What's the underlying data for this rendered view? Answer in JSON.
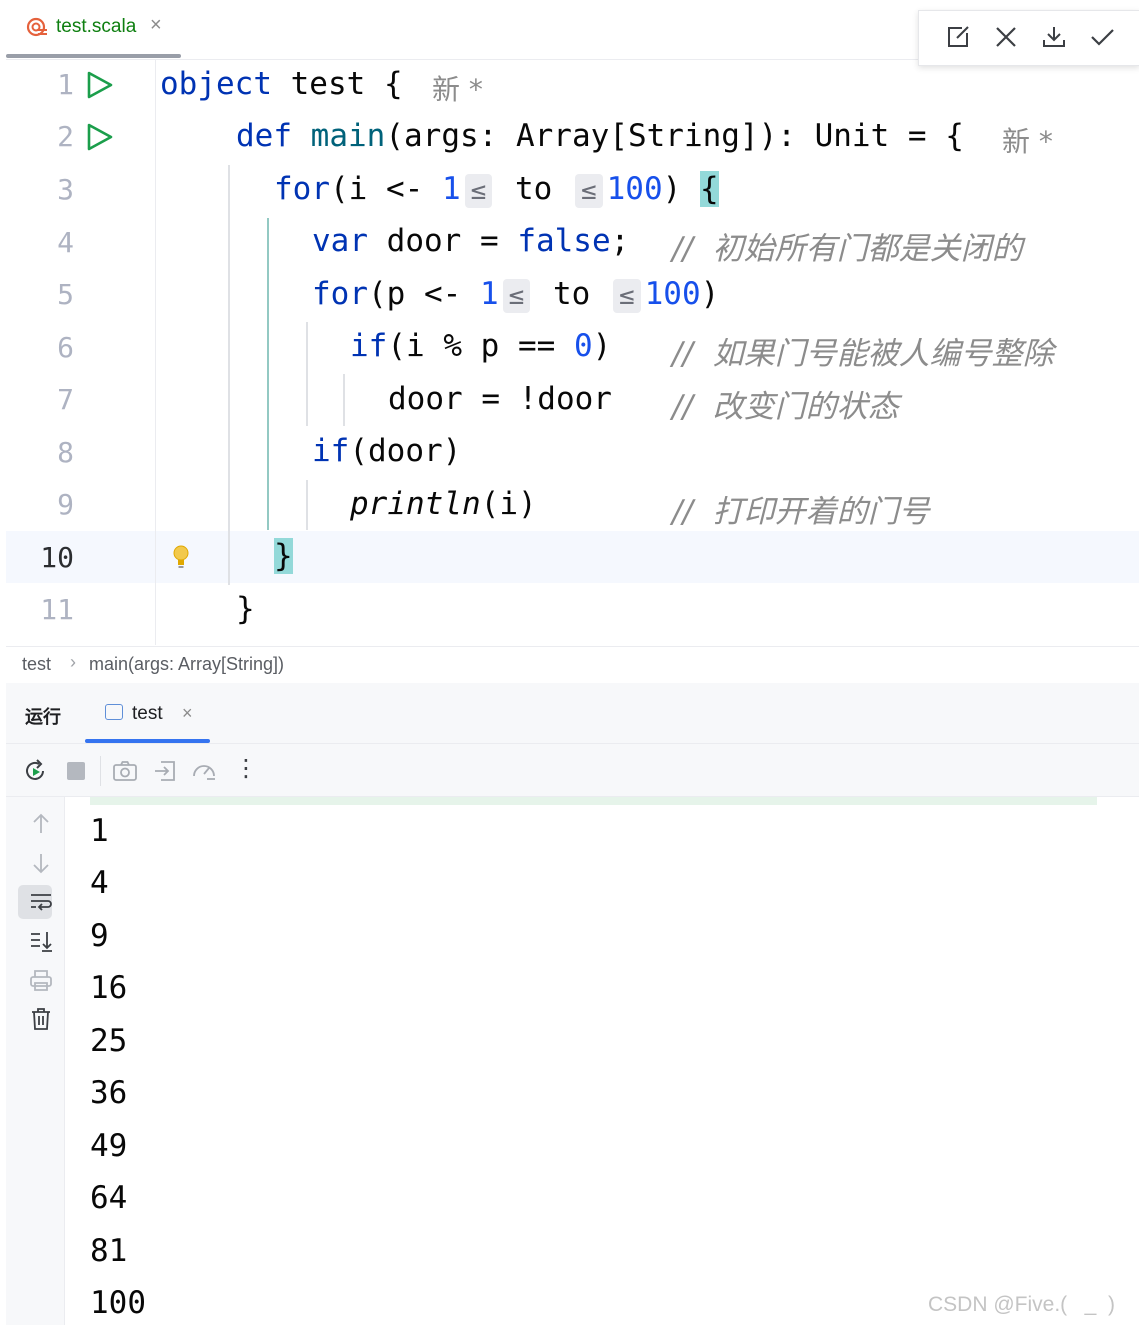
{
  "editor_tab": {
    "file_name": "test.scala",
    "close_glyph": "×",
    "icon": "scala-file-icon"
  },
  "diff_toolbar": {
    "icons": [
      "open-in-editor-icon",
      "close-icon",
      "download-icon",
      "check-icon"
    ]
  },
  "line_numbers": [
    "1",
    "2",
    "3",
    "4",
    "5",
    "6",
    "7",
    "8",
    "9",
    "10",
    "11"
  ],
  "active_line": "10",
  "code": {
    "l1": {
      "kw": "object",
      "name": " test ",
      "brace": "{",
      "author": "新 *"
    },
    "l2": {
      "kw": "def",
      "fn": "main",
      "sig": "(args: Array[String]): Unit = {",
      "author": "新 *"
    },
    "l3": {
      "kw": "for",
      "a": "(i <- ",
      "n1": "1",
      "h1": "≤",
      "to": " to ",
      "h2": "≤",
      "n2": "100",
      "b": ") ",
      "brace": "{"
    },
    "l4": {
      "kw": "var",
      "a": " door = ",
      "kw2": "false",
      "b": ";",
      "comment": "//  初始所有门都是关闭的"
    },
    "l5": {
      "kw": "for",
      "a": "(p <- ",
      "n1": "1",
      "h1": "≤",
      "to": " to ",
      "h2": "≤",
      "n2": "100",
      "b": ")"
    },
    "l6": {
      "kw": "if",
      "a": "(i % p == ",
      "n": "0",
      "b": ")",
      "comment": "//  如果门号能被人编号整除"
    },
    "l7": {
      "a": "door = !door",
      "comment": "//  改变门的状态"
    },
    "l8": {
      "kw": "if",
      "a": "(door)"
    },
    "l9": {
      "fn": "println",
      "a": "(i)",
      "comment": "//  打印开着的门号"
    },
    "l10": {
      "brace": "}"
    },
    "l11": {
      "brace": "}"
    }
  },
  "breadcrumb": {
    "items": [
      "test",
      "main(args: Array[String])"
    ],
    "separator": "›"
  },
  "run_panel": {
    "title": "运行",
    "tab_label": "test",
    "tab_close": "×"
  },
  "run_toolbar": {
    "icons": [
      "rerun-icon",
      "stop-icon",
      "screenshot-icon",
      "exit-icon",
      "profiler-icon",
      "more-icon"
    ],
    "more_glyph": "⋮"
  },
  "side_toolbar": {
    "icons": [
      "up-arrow-icon",
      "down-arrow-icon",
      "soft-wrap-icon",
      "scroll-to-end-icon",
      "print-icon",
      "trash-icon"
    ]
  },
  "console_output": [
    "1",
    "4",
    "9",
    "16",
    "25",
    "36",
    "49",
    "64",
    "81",
    "100"
  ],
  "watermark": "CSDN @Five.(   _  )",
  "colors": {
    "keyword": "#0033b3",
    "function": "#00627a",
    "number": "#1750eb",
    "comment": "#8c8c8c",
    "brace_highlight": "#93d9d9",
    "run_green": "#1b9e4b",
    "accent": "#3574f0"
  }
}
